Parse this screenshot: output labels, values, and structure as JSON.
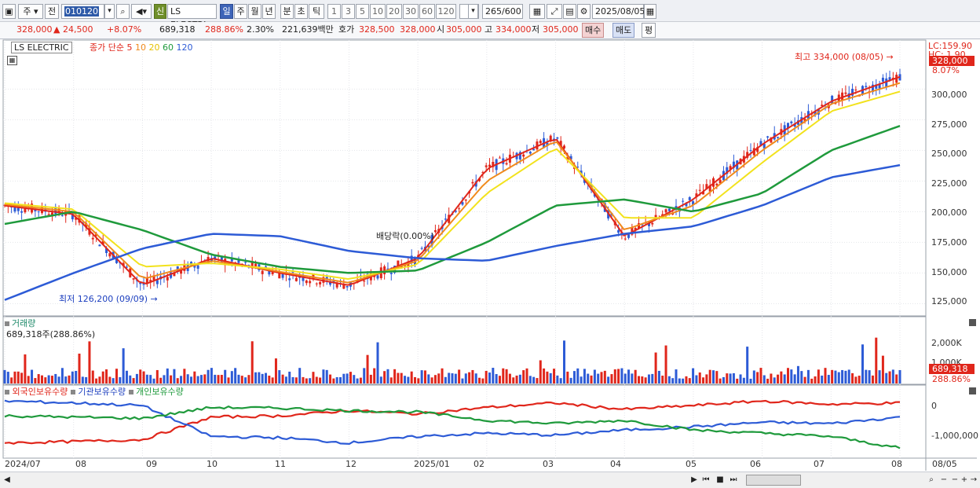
{
  "toolbar": {
    "period_label": "주",
    "prev_label": "전",
    "code": "010120",
    "new_label": "신",
    "stock_name": "LS ELECTRI",
    "periods": [
      "일",
      "주",
      "월",
      "년",
      "분",
      "초",
      "틱"
    ],
    "active_period": "일",
    "minutes": [
      "1",
      "3",
      "5",
      "10",
      "20",
      "30",
      "60",
      "120"
    ],
    "count": "265",
    "count_total": "/600",
    "date": "2025/08/05"
  },
  "quote": {
    "price": "328,000",
    "change": "▲ 24,500",
    "change_pct": "+8.07%",
    "volume": "689,318",
    "volume_ratio": "288.86%",
    "turnover_pct": "2.30%",
    "amount": "221,639백만",
    "bid_label": "호가",
    "bid1": "328,500",
    "bid2": "328,000",
    "open_label": "시",
    "open": "305,000",
    "high_label": "고",
    "high": "334,000",
    "low_label": "저",
    "low": "305,000",
    "buy_label": "매수",
    "sell_label": "매도",
    "eval_label": "평"
  },
  "price_pane": {
    "stock_label": "LS ELECTRIC",
    "ma_title": "종가 단순",
    "ma_periods": [
      {
        "label": "5",
        "color": "#e0261b"
      },
      {
        "label": "10",
        "color": "#f08a1c"
      },
      {
        "label": "20",
        "color": "#f2d51d"
      },
      {
        "label": "60",
        "color": "#1f9a3c"
      },
      {
        "label": "120",
        "color": "#2d5bd6"
      }
    ],
    "lc": "LC:159.90",
    "hc": "HC: 1.90",
    "last_price_tag": "328,000",
    "last_pct": "8.07%",
    "high_marker": "최고 334,000 (08/05)",
    "low_marker": "최저 126,200 (09/09)",
    "dividend_marker": "배당락(0.00%)",
    "y_ticks": [
      "300,000",
      "275,000",
      "250,000",
      "225,000",
      "200,000",
      "175,000",
      "150,000",
      "125,000"
    ]
  },
  "volume_pane": {
    "title": "거래량",
    "value": "689,318주(288.86%)",
    "y_ticks": [
      "2,000K",
      "1,000K"
    ],
    "last_tag": "689,318",
    "last_pct": "288.86%"
  },
  "investor_pane": {
    "series": [
      {
        "name": "외국인보유수량",
        "color": "#e0261b"
      },
      {
        "name": "기관보유수량",
        "color": "#2d5bd6"
      },
      {
        "name": "개인보유수량",
        "color": "#1f9a3c"
      }
    ],
    "y_ticks": [
      "0",
      "-1,000,000"
    ]
  },
  "x_axis": {
    "labels": [
      "2024/07",
      "08",
      "09",
      "10",
      "11",
      "12",
      "2025/01",
      "02",
      "03",
      "04",
      "05",
      "06",
      "07",
      "08"
    ],
    "right_label": "08/05"
  },
  "chart_data": {
    "type": "line",
    "x": [
      "2024/07",
      "08",
      "09",
      "10",
      "11",
      "12",
      "2025/01",
      "02",
      "03",
      "04",
      "05",
      "06",
      "07",
      "08"
    ],
    "ylim": [
      115000,
      340000
    ],
    "series": [
      {
        "name": "5",
        "values": [
          205000,
          198000,
          140000,
          162000,
          150000,
          140000,
          162000,
          235000,
          260000,
          180000,
          210000,
          255000,
          290000,
          310000
        ]
      },
      {
        "name": "10",
        "values": [
          206000,
          200000,
          145000,
          160000,
          151000,
          142000,
          160000,
          225000,
          258000,
          185000,
          205000,
          250000,
          288000,
          305000
        ]
      },
      {
        "name": "20",
        "values": [
          207000,
          202000,
          155000,
          158000,
          153000,
          145000,
          157000,
          215000,
          252000,
          195000,
          195000,
          240000,
          282000,
          298000
        ]
      },
      {
        "name": "60",
        "values": [
          190000,
          200000,
          185000,
          165000,
          155000,
          150000,
          152000,
          175000,
          205000,
          210000,
          200000,
          215000,
          250000,
          270000
        ]
      },
      {
        "name": "120",
        "values": [
          128000,
          150000,
          170000,
          182000,
          180000,
          168000,
          162000,
          160000,
          172000,
          182000,
          188000,
          205000,
          228000,
          238000
        ]
      }
    ]
  }
}
